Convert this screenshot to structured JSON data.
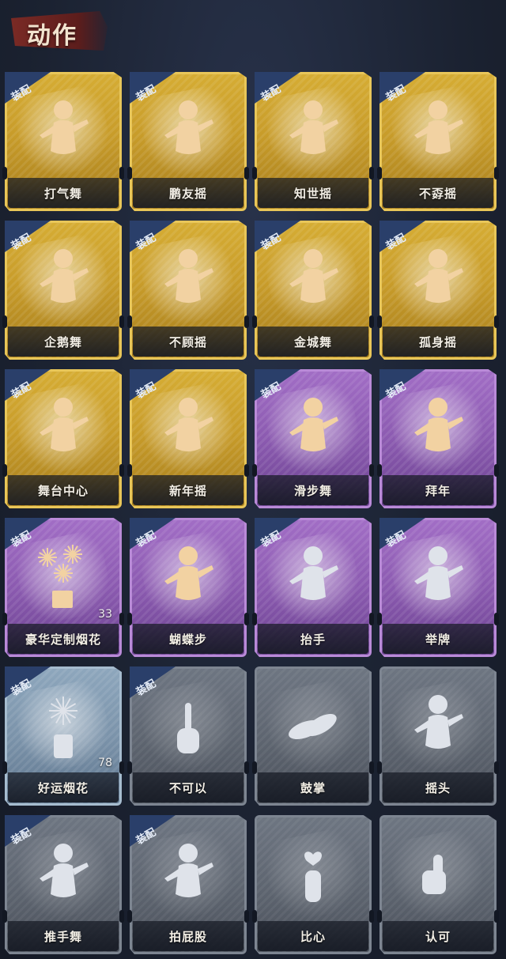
{
  "header": {
    "title": "动作"
  },
  "equip_label": "装配",
  "colors": {
    "gold": "#c89c2a",
    "purple": "#8b5ab0",
    "blue": "#7b93aa",
    "gray": "#5d646f",
    "badge": "#2a3f6a",
    "icon_gold": "#f2d2a2",
    "icon_silver": "#dfe3ea"
  },
  "cards": [
    {
      "name": "打气舞",
      "rarity": "gold",
      "equipped": true,
      "icon": "dance-figure-icon"
    },
    {
      "name": "鹏友摇",
      "rarity": "gold",
      "equipped": true,
      "icon": "dance-figure-icon"
    },
    {
      "name": "知世摇",
      "rarity": "gold",
      "equipped": true,
      "icon": "dance-figure-icon"
    },
    {
      "name": "不孬摇",
      "rarity": "gold",
      "equipped": true,
      "icon": "dance-figure-icon"
    },
    {
      "name": "企鹅舞",
      "rarity": "gold",
      "equipped": true,
      "icon": "dance-figure-icon"
    },
    {
      "name": "不顾摇",
      "rarity": "gold",
      "equipped": true,
      "icon": "dance-figure-icon"
    },
    {
      "name": "金城舞",
      "rarity": "gold",
      "equipped": true,
      "icon": "dance-figure-icon"
    },
    {
      "name": "孤身摇",
      "rarity": "gold",
      "equipped": true,
      "icon": "dance-figure-icon"
    },
    {
      "name": "舞台中心",
      "rarity": "gold",
      "equipped": true,
      "icon": "dance-figure-icon"
    },
    {
      "name": "新年摇",
      "rarity": "gold",
      "equipped": true,
      "icon": "dance-figure-icon"
    },
    {
      "name": "滑步舞",
      "rarity": "purple",
      "equipped": true,
      "icon": "dance-figure-icon"
    },
    {
      "name": "拜年",
      "rarity": "purple",
      "equipped": true,
      "icon": "bow-figure-icon"
    },
    {
      "name": "豪华定制烟花",
      "rarity": "purple",
      "equipped": true,
      "icon": "fireworks-box-icon",
      "count": "33"
    },
    {
      "name": "蝴蝶步",
      "rarity": "purple",
      "equipped": true,
      "icon": "dance-figure-icon"
    },
    {
      "name": "抬手",
      "rarity": "purple",
      "equipped": true,
      "icon": "raise-hand-icon"
    },
    {
      "name": "举牌",
      "rarity": "purple",
      "equipped": true,
      "icon": "hold-sign-icon"
    },
    {
      "name": "好运烟花",
      "rarity": "blue",
      "equipped": true,
      "icon": "firework-can-icon",
      "count": "78"
    },
    {
      "name": "不可以",
      "rarity": "gray",
      "equipped": true,
      "icon": "finger-wag-icon"
    },
    {
      "name": "鼓掌",
      "rarity": "gray",
      "equipped": false,
      "icon": "clap-icon"
    },
    {
      "name": "摇头",
      "rarity": "gray",
      "equipped": false,
      "icon": "shake-head-icon"
    },
    {
      "name": "推手舞",
      "rarity": "gray",
      "equipped": true,
      "icon": "push-hands-icon"
    },
    {
      "name": "拍屁股",
      "rarity": "gray",
      "equipped": true,
      "icon": "slap-icon"
    },
    {
      "name": "比心",
      "rarity": "gray",
      "equipped": false,
      "icon": "finger-heart-icon"
    },
    {
      "name": "认可",
      "rarity": "gray",
      "equipped": false,
      "icon": "thumbs-up-icon"
    }
  ]
}
